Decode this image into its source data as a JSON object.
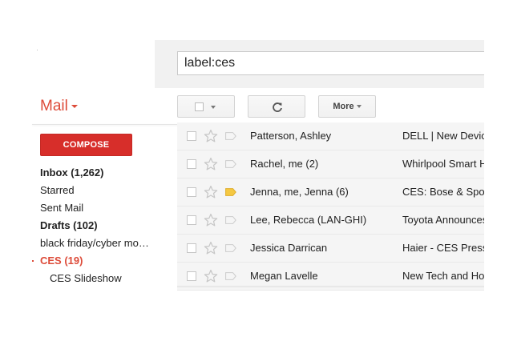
{
  "search": {
    "value": "label:ces"
  },
  "brand": {
    "label": "Mail",
    "color": "#dd4b39"
  },
  "compose": {
    "label": "COMPOSE",
    "color": "#d72e2a"
  },
  "nav": {
    "items": [
      {
        "label": "Inbox (1,262)",
        "style": "bold"
      },
      {
        "label": "Starred",
        "style": "normal"
      },
      {
        "label": "Sent Mail",
        "style": "normal"
      },
      {
        "label": "Drafts (102)",
        "style": "bold"
      },
      {
        "label": "black friday/cyber mo…",
        "style": "normal"
      },
      {
        "label": "CES (19)",
        "style": "active"
      },
      {
        "label": "CES Slideshow",
        "style": "sub"
      }
    ]
  },
  "toolbar": {
    "select_icon": "checkbox-icon",
    "refresh_icon": "refresh-icon",
    "more_label": "More"
  },
  "emails": [
    {
      "sender": "Patterson, Ashley",
      "subject": "DELL | New Devic",
      "important": false
    },
    {
      "sender": "Rachel, me (2)",
      "subject": "Whirlpool Smart H",
      "important": false
    },
    {
      "sender": "Jenna, me, Jenna (6)",
      "subject": "CES: Bose & Spo",
      "important": true
    },
    {
      "sender": "Lee, Rebecca (LAN-GHI)",
      "subject": "Toyota Announces",
      "important": false
    },
    {
      "sender": "Jessica Darrican",
      "subject": "Haier - CES Press",
      "important": false
    },
    {
      "sender": "Megan Lavelle",
      "subject": "New Tech and Ho",
      "important": false
    }
  ],
  "colors": {
    "important_marker": "#f5c842",
    "unmarked": "#cccccc"
  }
}
